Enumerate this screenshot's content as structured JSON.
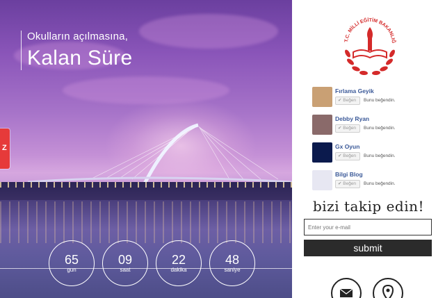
{
  "hero": {
    "subtitle": "Okulların açılmasına,",
    "title": "Kalan Süre",
    "counters": [
      {
        "value": "65",
        "unit": "gun"
      },
      {
        "value": "09",
        "unit": "saat"
      },
      {
        "value": "22",
        "unit": "dakika"
      },
      {
        "value": "48",
        "unit": "saniye"
      }
    ],
    "side_tab_icon": "z-mark-icon"
  },
  "sidebar": {
    "logo_text": "T.C. MİLLİ EĞİTİM BAKANLIĞI",
    "feed": [
      {
        "name": "Fırlama Geyik",
        "like_label": "✔ Beğen",
        "like_text": "Bunu beğendin.",
        "avatar_color": "#c9a074"
      },
      {
        "name": "Debby Ryan",
        "like_label": "✔ Beğen",
        "like_text": "Bunu beğendin.",
        "avatar_color": "#8a6a6a"
      },
      {
        "name": "Gx Oyun",
        "like_label": "✔ Beğen",
        "like_text": "Bunu beğendin.",
        "avatar_color": "#0b1a4d"
      },
      {
        "name": "Bilgi Blog",
        "like_label": "✔ Beğen",
        "like_text": "Bunu beğendin.",
        "avatar_color": "#e7e7f2"
      }
    ],
    "follow_title": "bizi takip edin!",
    "email_placeholder": "Enter your e-mail",
    "submit_label": "submit",
    "icons": [
      "envelope-icon",
      "location-pin-icon"
    ]
  },
  "colors": {
    "accent_red": "#e63a3a",
    "link_blue": "#3b5998",
    "submit_bg": "#2b2b2b",
    "logo_red": "#d42a2a"
  }
}
